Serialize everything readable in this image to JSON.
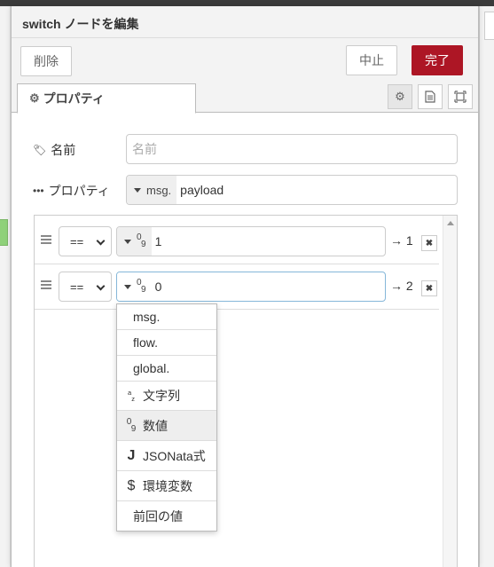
{
  "tray": {
    "title": "switch ノードを編集"
  },
  "toolbar": {
    "delete_label": "削除",
    "cancel_label": "中止",
    "done_label": "完了"
  },
  "tabs": {
    "properties_label": "プロパティ"
  },
  "form": {
    "name_label": "名前",
    "name_placeholder": "名前",
    "property_label": "プロパティ",
    "property_type": "msg.",
    "property_value": "payload"
  },
  "rules": [
    {
      "operator": "==",
      "value": "1",
      "output": "→ 1"
    },
    {
      "operator": "==",
      "value": "0",
      "output": "→ 2"
    }
  ],
  "dropdown": {
    "items": [
      {
        "label": "msg.",
        "icon": ""
      },
      {
        "label": "flow.",
        "icon": ""
      },
      {
        "label": "global.",
        "icon": ""
      },
      {
        "label": "文字列",
        "icon": "string-icon"
      },
      {
        "label": "数値",
        "icon": "number-icon"
      },
      {
        "label": "JSONata式",
        "icon": "jsonata-icon"
      },
      {
        "label": "環境変数",
        "icon": "env-icon"
      },
      {
        "label": "前回の値",
        "icon": ""
      }
    ]
  },
  "colors": {
    "done_button": "#ad1625",
    "focus_border": "#85b7d9"
  }
}
